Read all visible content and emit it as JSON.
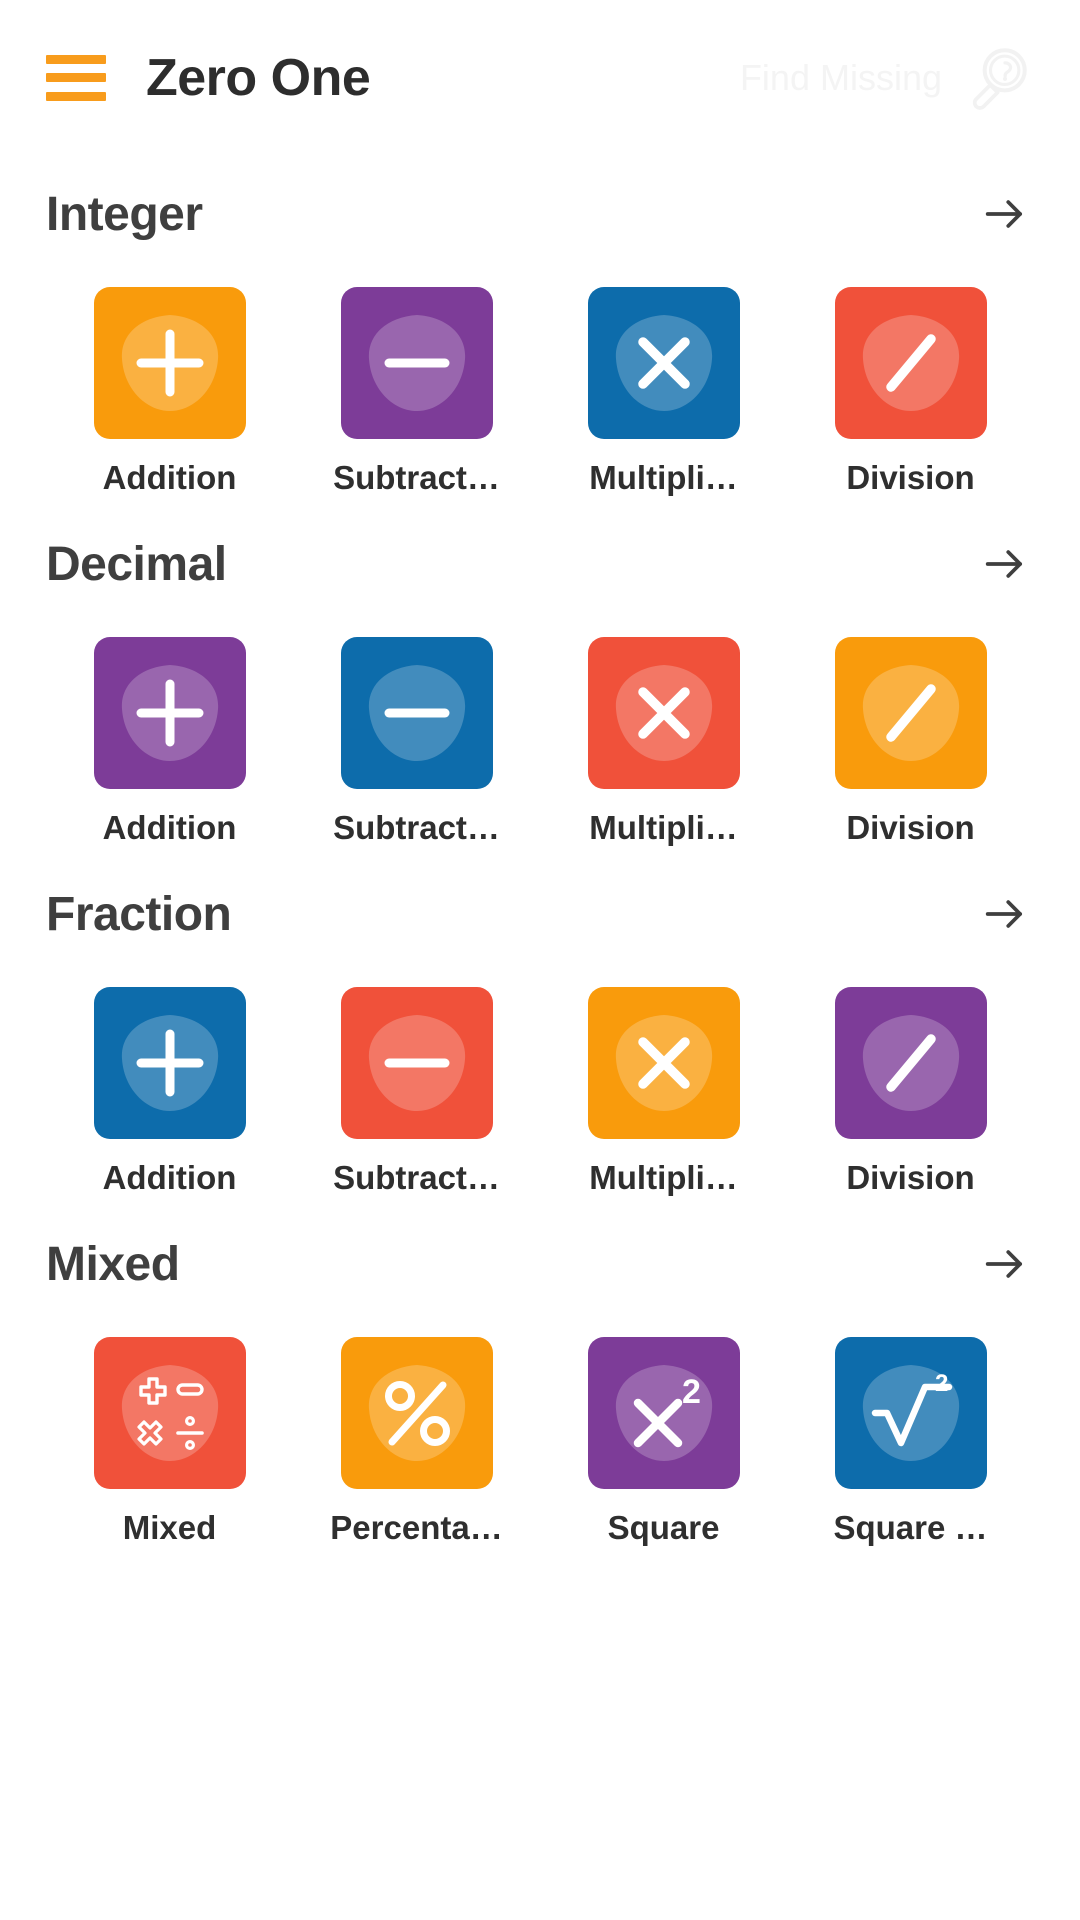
{
  "header": {
    "menu_icon": "hamburger-icon",
    "title": "Zero One",
    "find_missing_label": "Find Missing",
    "find_missing_icon": "magnifier-question-icon",
    "menu_color": "#F89C1C",
    "title_color": "#2d2d2d",
    "find_missing_color": "#f4f4f4"
  },
  "palette": {
    "orange": "#F99B0C",
    "purple": "#7D3C98",
    "blue": "#0D6CAB",
    "red": "#F0513A"
  },
  "sections": [
    {
      "title": "Integer",
      "arrow_icon": "arrow-right-icon",
      "tiles": [
        {
          "label": "Addition",
          "full_label": "Addition",
          "icon": "plus-icon",
          "color": "#F99B0C"
        },
        {
          "label": "Subtract…",
          "full_label": "Subtraction",
          "icon": "minus-icon",
          "color": "#7D3C98"
        },
        {
          "label": "Multipli…",
          "full_label": "Multiplication",
          "icon": "multiply-icon",
          "color": "#0D6CAB"
        },
        {
          "label": "Division",
          "full_label": "Division",
          "icon": "slash-icon",
          "color": "#F0513A"
        }
      ]
    },
    {
      "title": "Decimal",
      "arrow_icon": "arrow-right-icon",
      "tiles": [
        {
          "label": "Addition",
          "full_label": "Addition",
          "icon": "plus-icon",
          "color": "#7D3C98"
        },
        {
          "label": "Subtract…",
          "full_label": "Subtraction",
          "icon": "minus-icon",
          "color": "#0D6CAB"
        },
        {
          "label": "Multipli…",
          "full_label": "Multiplication",
          "icon": "multiply-icon",
          "color": "#F0513A"
        },
        {
          "label": "Division",
          "full_label": "Division",
          "icon": "slash-icon",
          "color": "#F99B0C"
        }
      ]
    },
    {
      "title": "Fraction",
      "arrow_icon": "arrow-right-icon",
      "tiles": [
        {
          "label": "Addition",
          "full_label": "Addition",
          "icon": "plus-icon",
          "color": "#0D6CAB"
        },
        {
          "label": "Subtract…",
          "full_label": "Subtraction",
          "icon": "minus-icon",
          "color": "#F0513A"
        },
        {
          "label": "Multipli…",
          "full_label": "Multiplication",
          "icon": "multiply-icon",
          "color": "#F99B0C"
        },
        {
          "label": "Division",
          "full_label": "Division",
          "icon": "slash-icon",
          "color": "#7D3C98"
        }
      ]
    },
    {
      "title": "Mixed",
      "arrow_icon": "arrow-right-icon",
      "tiles": [
        {
          "label": "Mixed",
          "full_label": "Mixed",
          "icon": "mixed-operators-icon",
          "color": "#F0513A"
        },
        {
          "label": "Percenta…",
          "full_label": "Percentage",
          "icon": "percent-icon",
          "color": "#F99B0C"
        },
        {
          "label": "Square",
          "full_label": "Square",
          "icon": "x-squared-icon",
          "color": "#7D3C98"
        },
        {
          "label": "Square …",
          "full_label": "Square Root",
          "icon": "square-root-icon",
          "color": "#0D6CAB"
        }
      ]
    }
  ]
}
